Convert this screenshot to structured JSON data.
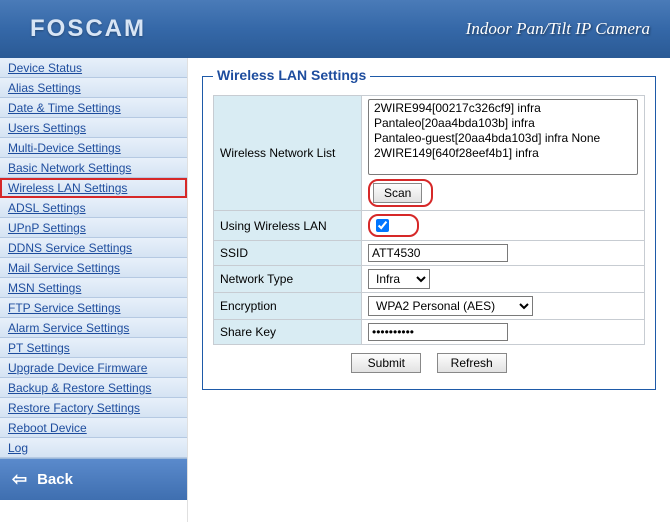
{
  "header": {
    "brand": "FOSCAM",
    "title": "Indoor Pan/Tilt IP Camera"
  },
  "sidebar": {
    "active_index": 6,
    "items": [
      {
        "label": "Device Status"
      },
      {
        "label": "Alias Settings"
      },
      {
        "label": "Date & Time Settings"
      },
      {
        "label": "Users Settings"
      },
      {
        "label": "Multi-Device Settings"
      },
      {
        "label": "Basic Network Settings"
      },
      {
        "label": "Wireless LAN Settings"
      },
      {
        "label": "ADSL Settings"
      },
      {
        "label": "UPnP Settings"
      },
      {
        "label": "DDNS Service Settings"
      },
      {
        "label": "Mail Service Settings"
      },
      {
        "label": "MSN Settings"
      },
      {
        "label": "FTP Service Settings"
      },
      {
        "label": "Alarm Service Settings"
      },
      {
        "label": "PT Settings"
      },
      {
        "label": "Upgrade Device Firmware"
      },
      {
        "label": "Backup & Restore Settings"
      },
      {
        "label": "Restore Factory Settings"
      },
      {
        "label": "Reboot Device"
      },
      {
        "label": "Log"
      }
    ],
    "back_label": "Back"
  },
  "panel": {
    "title": "Wireless LAN Settings",
    "labels": {
      "network_list": "Wireless Network List",
      "using_wlan": "Using Wireless LAN",
      "ssid": "SSID",
      "network_type": "Network Type",
      "encryption": "Encryption",
      "share_key": "Share Key"
    },
    "network_list": [
      "2WIRE994[00217c326cf9] infra",
      "Pantaleo[20aa4bda103b] infra",
      "Pantaleo-guest[20aa4bda103d] infra None",
      "2WIRE149[640f28eef4b1] infra"
    ],
    "scan_button": "Scan",
    "using_wlan_checked": true,
    "ssid_value": "ATT4530",
    "network_type_value": "Infra",
    "encryption_value": "WPA2 Personal (AES)",
    "share_key_value": "●●●●●●●●●●",
    "submit_button": "Submit",
    "refresh_button": "Refresh"
  }
}
